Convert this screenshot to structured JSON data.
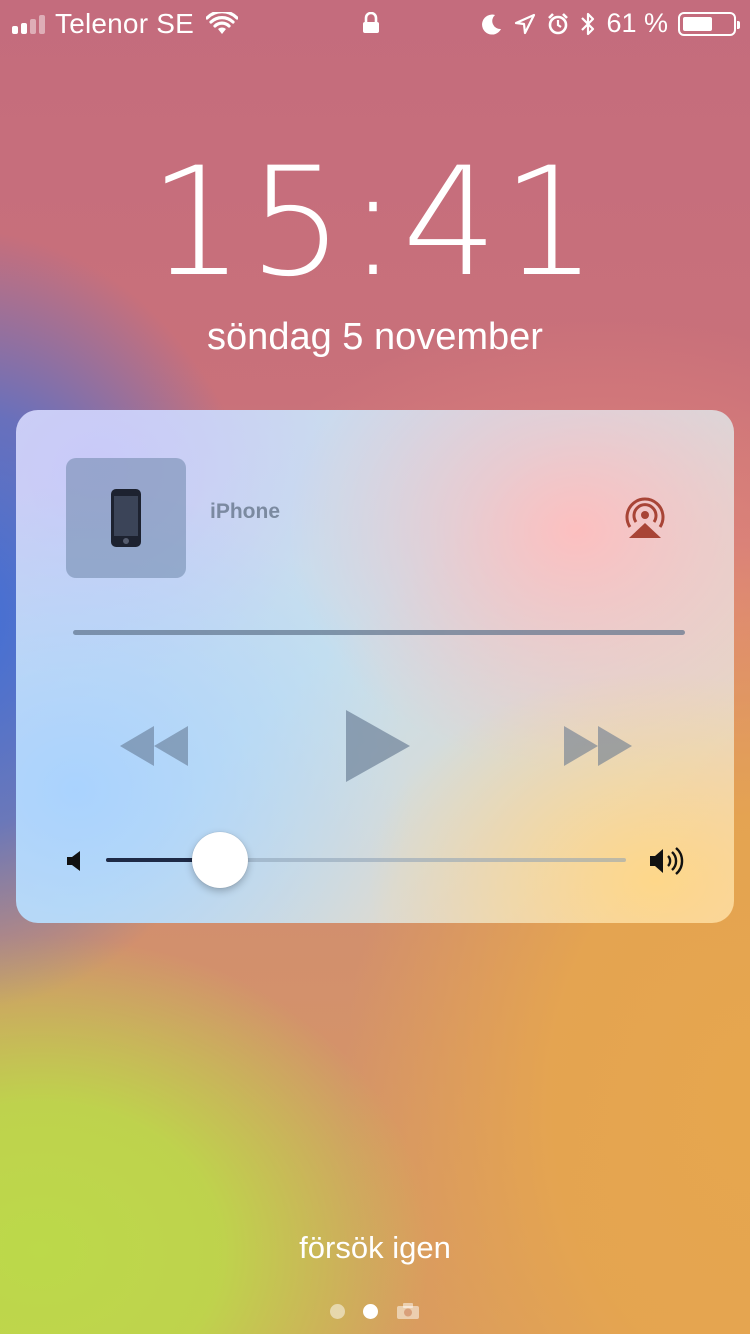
{
  "status_bar": {
    "carrier": "Telenor SE",
    "battery_percent": "61 %",
    "battery_level": 0.61,
    "signal_bars": 4,
    "signal_bars_active": 2,
    "icons": [
      "signal-icon",
      "wifi-icon",
      "lock-icon",
      "moon-icon",
      "location-icon",
      "alarm-icon",
      "bluetooth-icon",
      "battery-icon"
    ]
  },
  "lockscreen": {
    "time": "15:41",
    "date": "söndag 5 november",
    "retry_label": "försök igen",
    "page_dots": 2,
    "active_dot": 2
  },
  "media": {
    "device_name": "iPhone",
    "volume_level": 0.22,
    "accent_color": "#a84436",
    "icons": [
      "airplay-icon",
      "rewind-icon",
      "play-icon",
      "forward-icon",
      "volume-low-icon",
      "volume-high-icon"
    ]
  }
}
